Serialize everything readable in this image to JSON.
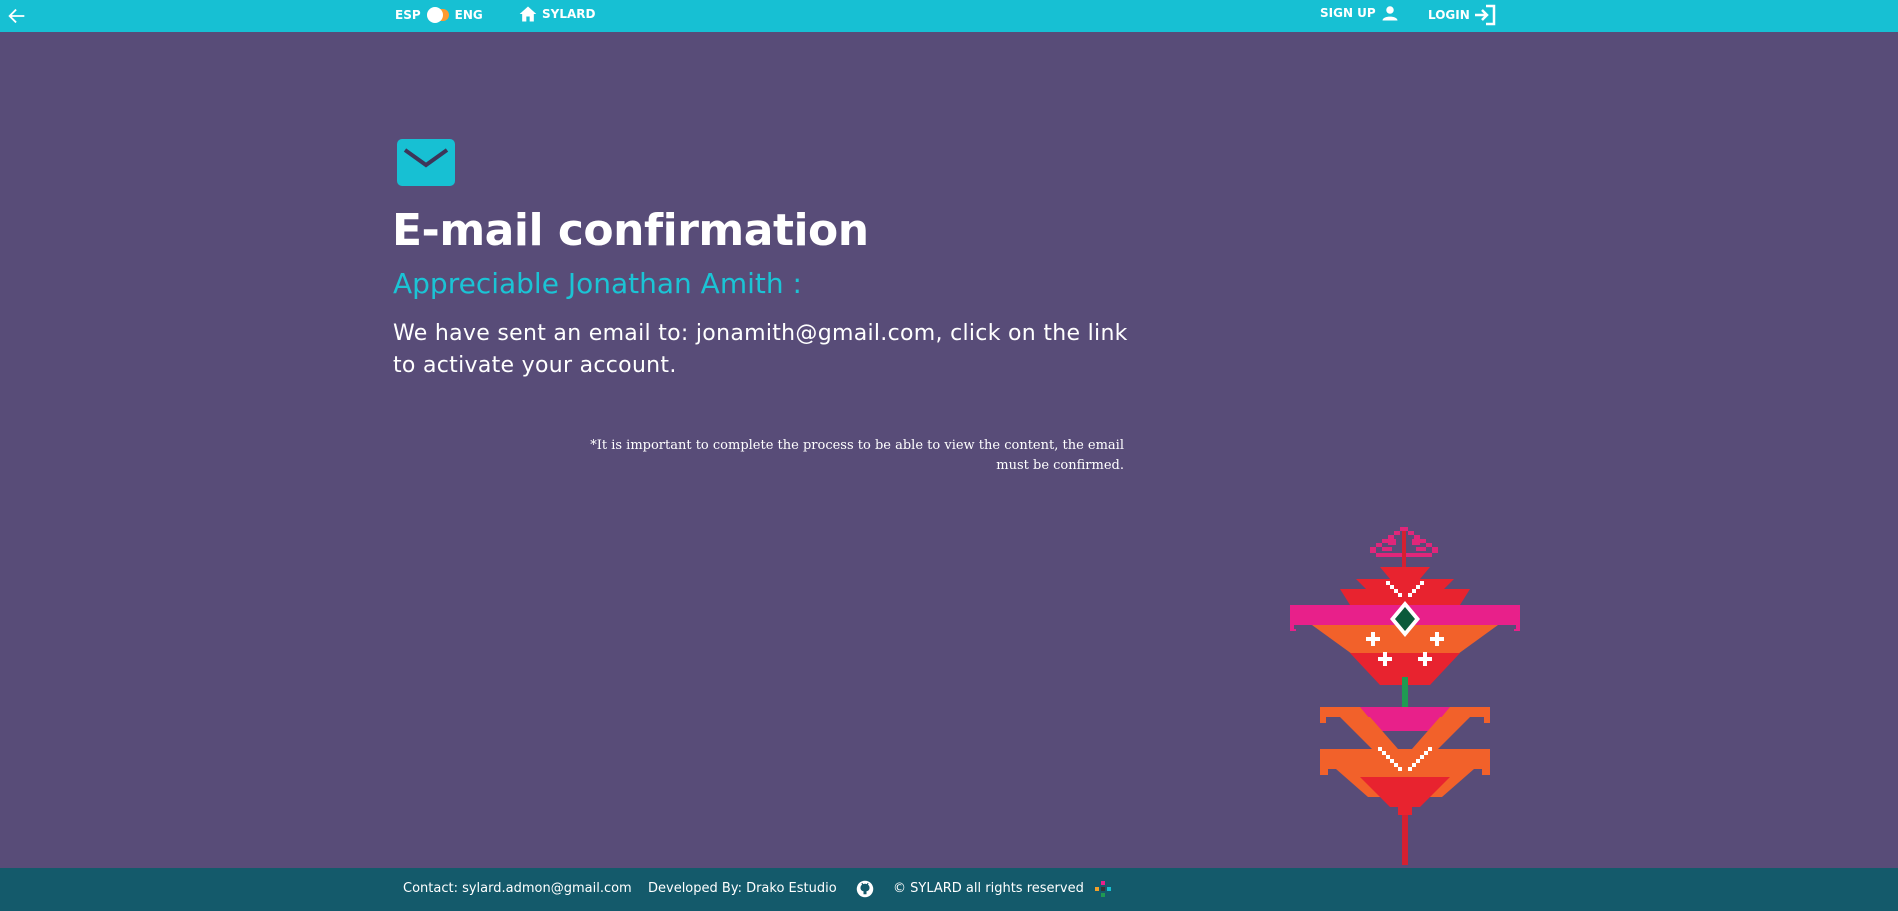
{
  "header": {
    "back_icon": "arrow-left-icon",
    "lang_left": "ESP",
    "lang_right": "ENG",
    "home_icon": "home-icon",
    "home_label": "SYLARD",
    "signup_label": "SIGN UP",
    "signup_icon": "user-icon",
    "login_label": "LOGIN",
    "login_icon": "login-icon"
  },
  "main": {
    "icon": "envelope-icon",
    "title": "E-mail confirmation",
    "greeting": "Appreciable Jonathan Amith :",
    "message": "We have sent an email to: jonamith@gmail.com, click on the link to activate your account.",
    "note": "*It is important to complete the process to be able to view the content, the email must be confirmed."
  },
  "footer": {
    "contact": "Contact: sylard.admon@gmail.com",
    "developer": "Developed By: Drako Estudio",
    "github_icon": "github-icon",
    "rights": "© SYLARD all rights reserved",
    "logo_icon": "sylard-logo-icon"
  },
  "colors": {
    "header_bg": "#17c0d3",
    "page_bg": "#584c78",
    "footer_bg": "#145a6b",
    "accent": "#1bc4d5",
    "toggle": "#ff9a2e"
  }
}
